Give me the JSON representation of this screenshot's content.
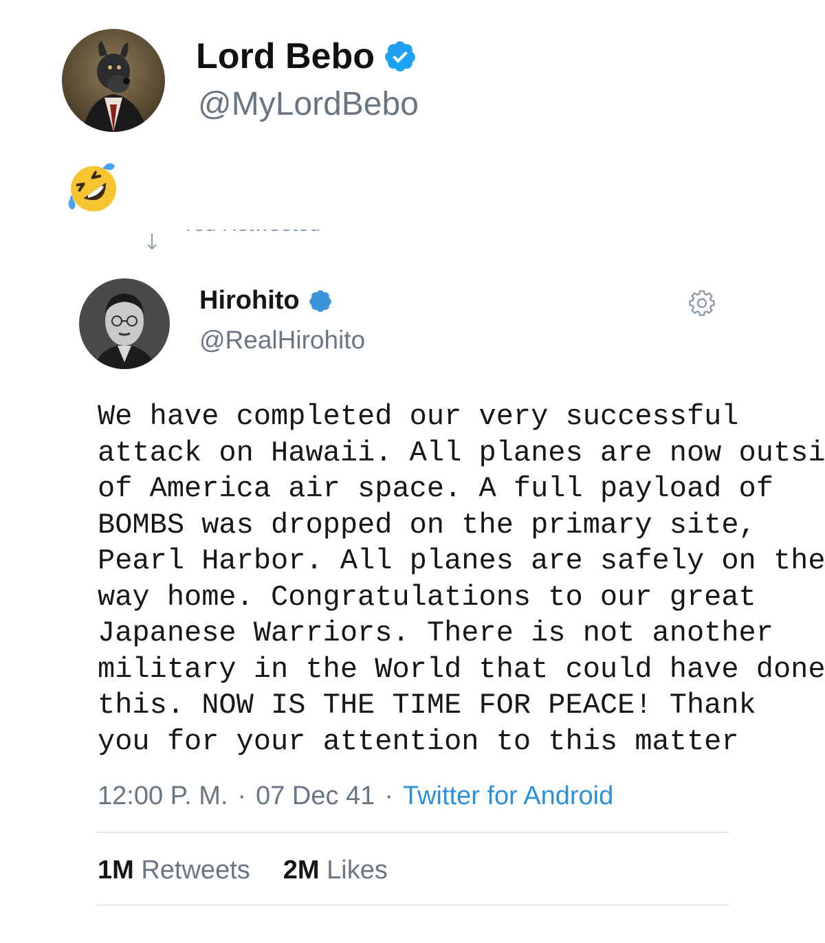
{
  "outer_tweet": {
    "author_name": "Lord Bebo",
    "author_handle": "@MyLordBebo",
    "verified": true,
    "emoji_icon": "rolling-on-floor-laughing"
  },
  "retweet_banner": {
    "text": "You Retweeted"
  },
  "quoted_tweet": {
    "author_name": "Hirohito",
    "author_handle": "@RealHirohito",
    "verified": true,
    "body_lines": [
      "We have completed our very successful",
      "attack on Hawaii. All planes are now outside",
      "of America air space. A full payload of",
      "BOMBS was dropped on the primary site,",
      "Pearl Harbor. All planes are safely on their",
      "way home. Congratulations to our great",
      "Japanese Warriors. There is not another",
      "military in the World that could have done",
      "this. NOW IS THE TIME FOR PEACE! Thank",
      "you for your attention to this matter"
    ],
    "time": "12:00 P. M.",
    "date": "07 Dec 41",
    "source": "Twitter for Android",
    "separator": "·",
    "retweets_count": "1M",
    "retweets_label": "Retweets",
    "likes_count": "2M",
    "likes_label": "Likes"
  },
  "colors": {
    "verified_blue": "#1da1f2",
    "link_blue": "#2b90d9",
    "muted_gray": "#687684",
    "divider": "#e1e8ed"
  }
}
